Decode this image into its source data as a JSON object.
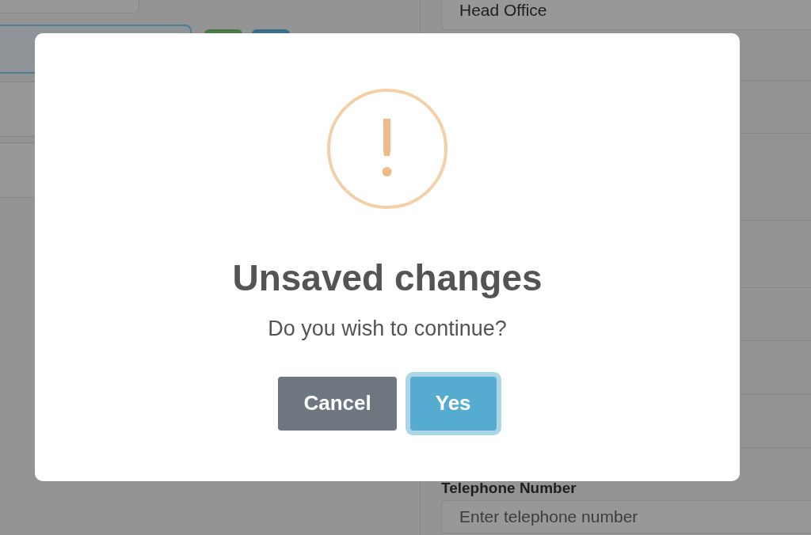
{
  "background": {
    "office_field": {
      "value": "Head Office"
    },
    "telephone": {
      "label": "Telephone Number",
      "placeholder": "Enter telephone number"
    }
  },
  "modal": {
    "icon": {
      "kind": "warning"
    },
    "title": "Unsaved changes",
    "message": "Do you wish to continue?",
    "buttons": [
      {
        "label": "Cancel",
        "kind": "secondary",
        "focused": false
      },
      {
        "label": "Yes",
        "kind": "primary",
        "focused": true
      }
    ]
  }
}
